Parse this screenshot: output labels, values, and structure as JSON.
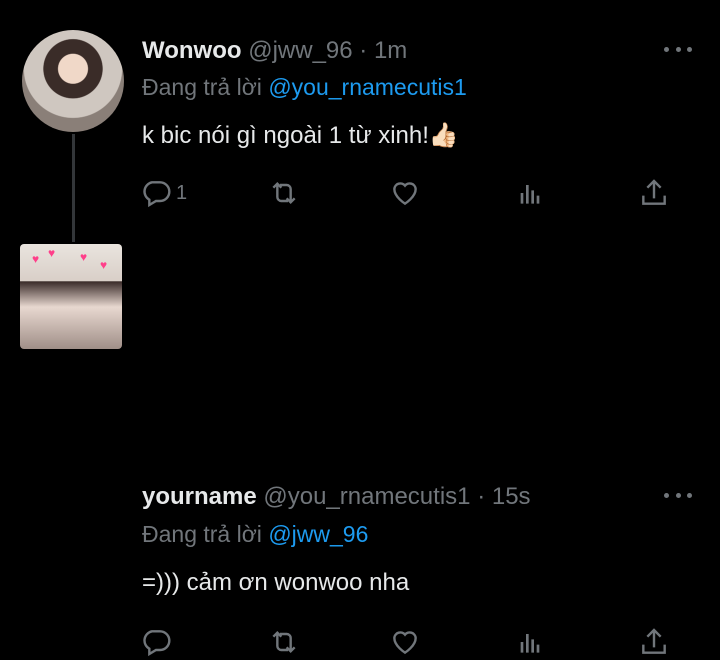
{
  "tweets": [
    {
      "name": "Wonwoo",
      "handle": "@jww_96",
      "sep": "·",
      "time": "1m",
      "reply_prefix": "Đang trả lời",
      "reply_to": "@you_rnamecutis1",
      "text": "k bic nói gì ngoài 1 từ xinh!👍🏻",
      "reply_count": "1",
      "avatar_icon": "profile-photo-man"
    },
    {
      "name": "yourname",
      "handle": "@you_rnamecutis1",
      "sep": "·",
      "time": "15s",
      "reply_prefix": "Đang trả lời",
      "reply_to": "@jww_96",
      "text": "=))) cảm ơn wonwoo nha",
      "reply_count": "",
      "avatar_icon": "profile-photo-girl"
    }
  ],
  "colors": {
    "background": "#000000",
    "text": "#e7e9ea",
    "muted": "#71767b",
    "link": "#1d9bf0"
  },
  "icons": [
    "reply-icon",
    "retweet-icon",
    "like-icon",
    "analytics-icon",
    "share-icon",
    "more-icon"
  ]
}
